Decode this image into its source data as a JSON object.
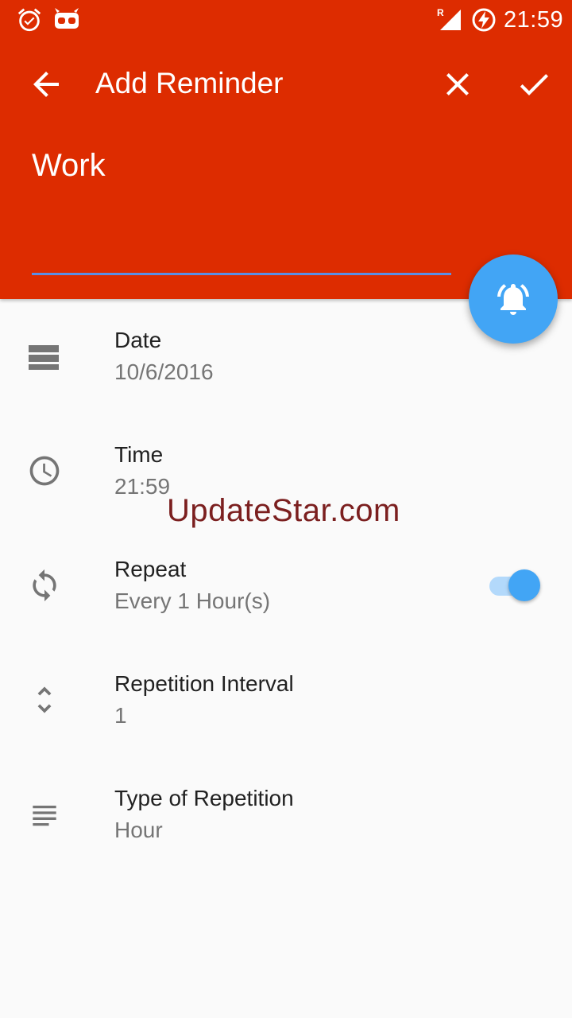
{
  "status_bar": {
    "time": "21:59",
    "icons": [
      "alarm-icon",
      "cyanogen-icon",
      "roaming-signal-icon",
      "battery-charging-icon"
    ]
  },
  "toolbar": {
    "title": "Add Reminder",
    "icons": [
      "back-arrow-icon",
      "close-icon",
      "check-icon"
    ]
  },
  "reminder": {
    "title_value": "Work"
  },
  "fab": {
    "icon": "bell-ringing-icon"
  },
  "fields": {
    "date": {
      "label": "Date",
      "value": "10/6/2016",
      "icon": "calendar-icon"
    },
    "time": {
      "label": "Time",
      "value": "21:59",
      "icon": "clock-icon"
    },
    "repeat": {
      "label": "Repeat",
      "value": "Every 1 Hour(s)",
      "icon": "repeat-icon",
      "toggle_on": true
    },
    "interval": {
      "label": "Repetition Interval",
      "value": "1",
      "icon": "unfold-icon"
    },
    "type": {
      "label": "Type of Repetition",
      "value": "Hour",
      "icon": "list-icon"
    }
  },
  "watermark": "UpdateStar.com",
  "colors": {
    "header": "#dd2c00",
    "accent": "#42a5f5",
    "background": "#fafafa"
  }
}
